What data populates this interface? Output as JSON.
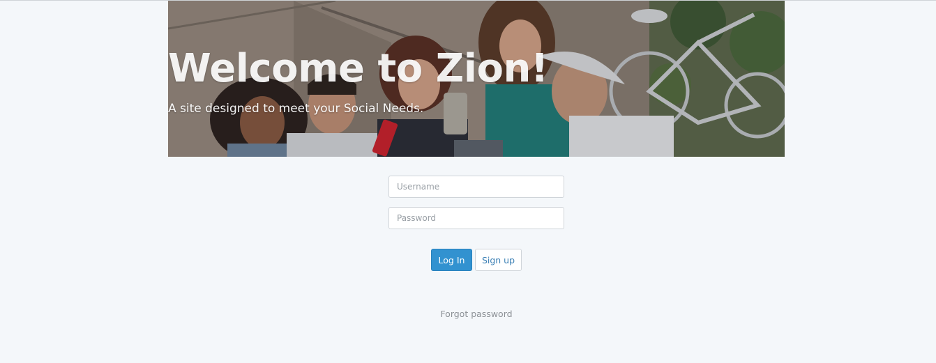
{
  "hero": {
    "title": "Welcome to Zion!",
    "subtitle": "A site designed to meet your Social Needs."
  },
  "login_form": {
    "username_placeholder": "Username",
    "password_placeholder": "Password",
    "login_label": "Log In",
    "signup_label": "Sign up",
    "forgot_label": "Forgot password"
  },
  "colors": {
    "page_background": "#f4f7fa",
    "primary_button": "#3292d0",
    "signup_text": "#3a7fb4",
    "link_text": "#8c9196"
  }
}
